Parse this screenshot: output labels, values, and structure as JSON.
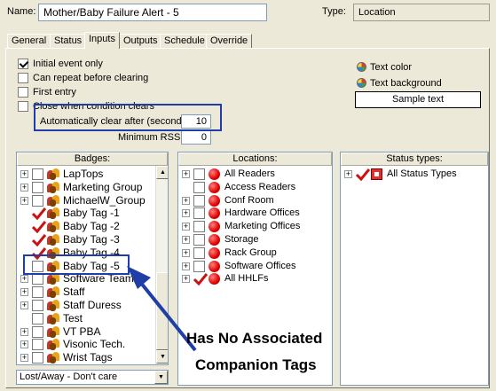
{
  "header": {
    "name_label": "Name:",
    "name_value": "Mother/Baby Failure Alert - 5",
    "type_label": "Type:",
    "type_value": "Location"
  },
  "tabs": [
    {
      "label": "General",
      "active": false
    },
    {
      "label": "Status",
      "active": false
    },
    {
      "label": "Inputs",
      "active": true
    },
    {
      "label": "Outputs",
      "active": false
    },
    {
      "label": "Schedule",
      "active": false
    },
    {
      "label": "Override",
      "active": false
    }
  ],
  "options": {
    "initial_event_only": {
      "label": "Initial event only",
      "checked": true
    },
    "can_repeat": {
      "label": "Can repeat before clearing",
      "checked": false
    },
    "first_entry": {
      "label": "First entry",
      "checked": false
    },
    "close_when_clears": {
      "label": "Close when condition clears",
      "checked": false
    },
    "auto_clear_label": "Automatically clear after (seconds):",
    "auto_clear_value": "10",
    "min_rssi_label": "Minimum RSSI:",
    "min_rssi_value": "0"
  },
  "appearance": {
    "text_color_label": "Text color",
    "text_background_label": "Text background",
    "sample_text": "Sample text"
  },
  "badges": {
    "header": "Badges:",
    "items": [
      {
        "label": "LapTops",
        "expander": true,
        "state": "unchecked",
        "icon": "group-icon"
      },
      {
        "label": "Marketing Group",
        "expander": true,
        "state": "unchecked",
        "icon": "group-icon"
      },
      {
        "label": "MichaelW_Group",
        "expander": true,
        "state": "unchecked",
        "icon": "group-icon"
      },
      {
        "label": "Baby Tag -1",
        "expander": false,
        "state": "checked",
        "icon": "group-icon"
      },
      {
        "label": "Baby Tag -2",
        "expander": false,
        "state": "checked",
        "icon": "group-icon"
      },
      {
        "label": "Baby Tag -3",
        "expander": false,
        "state": "checked",
        "icon": "group-icon"
      },
      {
        "label": "Baby Tag -4",
        "expander": false,
        "state": "checked",
        "icon": "group-icon"
      },
      {
        "label": "Baby Tag -5",
        "expander": false,
        "state": "unchecked",
        "icon": "group-icon"
      },
      {
        "label": "Software Team",
        "expander": true,
        "state": "unchecked",
        "icon": "group-icon"
      },
      {
        "label": "Staff",
        "expander": true,
        "state": "unchecked",
        "icon": "group-icon"
      },
      {
        "label": "Staff Duress",
        "expander": true,
        "state": "unchecked",
        "icon": "group-icon"
      },
      {
        "label": "Test",
        "expander": false,
        "state": "unchecked",
        "icon": "group-icon"
      },
      {
        "label": "VT PBA",
        "expander": true,
        "state": "unchecked",
        "icon": "group-icon"
      },
      {
        "label": "Visonic Tech.",
        "expander": true,
        "state": "unchecked",
        "icon": "group-icon"
      },
      {
        "label": "Wrist Tags",
        "expander": true,
        "state": "unchecked",
        "icon": "group-icon"
      }
    ],
    "dropdown_value": "Lost/Away - Don't care"
  },
  "locations": {
    "header": "Locations:",
    "items": [
      {
        "label": "All Readers",
        "expander": true,
        "state": "unchecked"
      },
      {
        "label": "Access Readers",
        "expander": false,
        "state": "unchecked"
      },
      {
        "label": "Conf Room",
        "expander": true,
        "state": "unchecked"
      },
      {
        "label": "Hardware Offices",
        "expander": true,
        "state": "unchecked"
      },
      {
        "label": "Marketing Offices",
        "expander": true,
        "state": "unchecked"
      },
      {
        "label": "Storage",
        "expander": true,
        "state": "unchecked"
      },
      {
        "label": "Rack Group",
        "expander": true,
        "state": "unchecked"
      },
      {
        "label": "Software Offices",
        "expander": true,
        "state": "unchecked"
      },
      {
        "label": "All HHLFs",
        "expander": true,
        "state": "checked"
      }
    ]
  },
  "status_types": {
    "header": "Status types:",
    "items": [
      {
        "label": "All Status Types",
        "expander": true,
        "state": "checked"
      }
    ]
  },
  "annotation": {
    "line1": "Has No Associated",
    "line2": "Companion Tags",
    "color": "#1f3ea6"
  }
}
